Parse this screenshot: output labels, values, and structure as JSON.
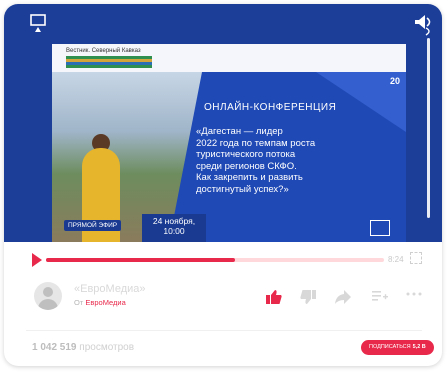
{
  "player": {
    "cast_icon": "cast-icon",
    "volume_icon": "volume-icon",
    "slide": {
      "brand_text": "Вестник. Северный Кавказ",
      "badge": "20",
      "title": "ОНЛАЙН-КОНФЕРЕНЦИЯ",
      "body": "«Дагестан — лидер\n2022 года по темпам роста\nтуристического потока\nсреди регионов СКФО.\nКак закрепить и развить\nдостигнутый успех?»",
      "live_label": "ПРЯМОЙ ЭФИР",
      "date": "24 ноября,",
      "time": "10:00"
    },
    "progress": 0.56,
    "duration": "8:24",
    "colors": {
      "accent": "#e8294b",
      "player_bg": "#1c3e99"
    }
  },
  "channel": {
    "name": "«ЕвроМедиа»",
    "author_prefix": "От",
    "author_name": "ЕвроМедиа"
  },
  "actions": {
    "like_icon": "thumbs-up-icon",
    "dislike_icon": "thumbs-down-icon",
    "share_icon": "share-icon",
    "queue_icon": "add-to-queue-icon",
    "more_icon": "more-icon"
  },
  "stats": {
    "views_count": "1 042 519",
    "views_label": "просмотров"
  },
  "subscribe": {
    "label": "ПОДПИСАТЬСЯ",
    "count": "5,2 В"
  }
}
